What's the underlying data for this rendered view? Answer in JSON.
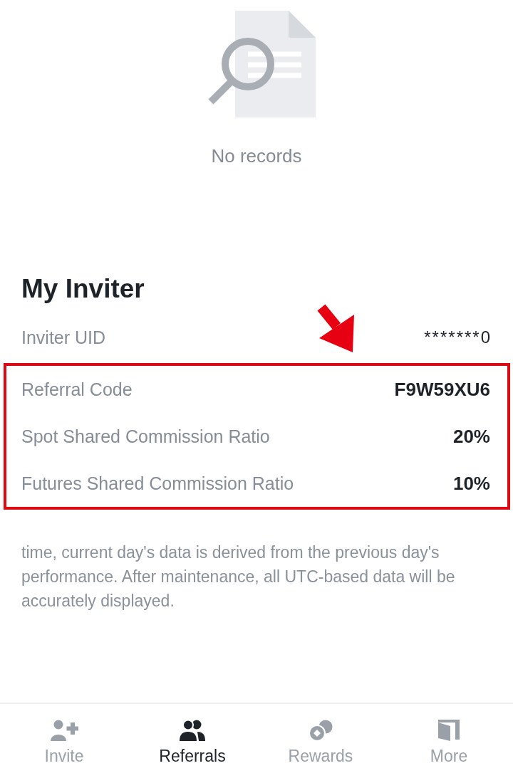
{
  "empty_state": {
    "message": "No records"
  },
  "inviter": {
    "title": "My Inviter",
    "rows": [
      {
        "label": "Inviter UID",
        "value": "*******0",
        "highlighted": false
      },
      {
        "label": "Referral Code",
        "value": "F9W59XU6",
        "highlighted": true
      },
      {
        "label": "Spot Shared Commission Ratio",
        "value": "20%",
        "highlighted": true
      },
      {
        "label": "Futures Shared Commission Ratio",
        "value": "10%",
        "highlighted": true
      }
    ]
  },
  "note": {
    "text": "time, current day's data is derived from the previous day's performance. After maintenance, all UTC-based data will be accurately displayed."
  },
  "tab_bar": {
    "tabs": [
      {
        "label": "Invite",
        "selected": false
      },
      {
        "label": "Referrals",
        "selected": true
      },
      {
        "label": "Rewards",
        "selected": false
      },
      {
        "label": "More",
        "selected": false
      }
    ]
  }
}
